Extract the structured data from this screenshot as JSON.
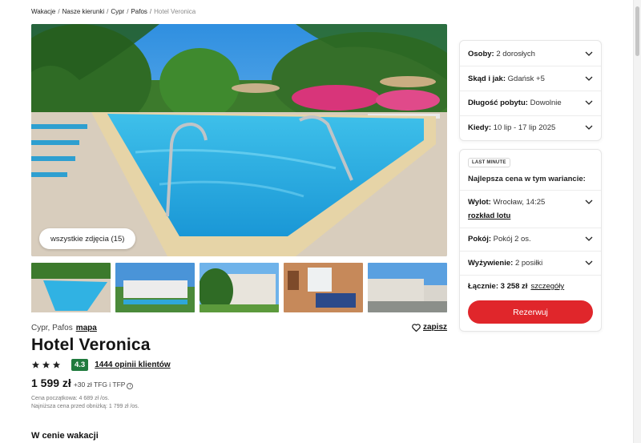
{
  "breadcrumb": {
    "items": [
      "Wakacje",
      "Nasze kierunki",
      "Cypr",
      "Pafos"
    ],
    "current": "Hotel Veronica",
    "separator": "/"
  },
  "gallery": {
    "all_photos_label": "wszystkie zdjęcia (15)"
  },
  "hotel": {
    "location": "Cypr, Pafos",
    "map_label": "mapa",
    "save_label": "zapisz",
    "name": "Hotel Veronica",
    "stars": 3,
    "rating": "4.3",
    "reviews_label": "1444 opinii klientów",
    "price": "1 599 zł",
    "price_extra": "+30 zł TFG i TFP",
    "start_price_note": "Cena początkowa: 4 689 zł /os.",
    "lowest_price_note": "Najniższa cena przed obniżką: 1 799 zł /os."
  },
  "section": {
    "title": "W cenie wakacji"
  },
  "search": {
    "people_label": "Osoby:",
    "people_value": "2 dorosłych",
    "from_label": "Skąd i jak:",
    "from_value": "Gdańsk +5",
    "duration_label": "Długość pobytu:",
    "duration_value": "Dowolnie",
    "when_label": "Kiedy:",
    "when_value": "10 lip - 17 lip 2025"
  },
  "offer": {
    "badge": "LAST MINUTE",
    "best_price": "Najlepsza cena w tym wariancie:",
    "departure_label": "Wylot:",
    "departure_value": "Wrocław, 14:25",
    "flight_schedule": "rozkład lotu",
    "room_label": "Pokój:",
    "room_value": "Pokój 2 os.",
    "board_label": "Wyżywienie:",
    "board_value": "2 posiłki",
    "total_label": "Łącznie: 3 258 zł",
    "details_label": "szczegóły",
    "reserve_label": "Rezerwuj"
  },
  "colors": {
    "accent_red": "#e0262b",
    "rating_green": "#1f7a3d"
  }
}
